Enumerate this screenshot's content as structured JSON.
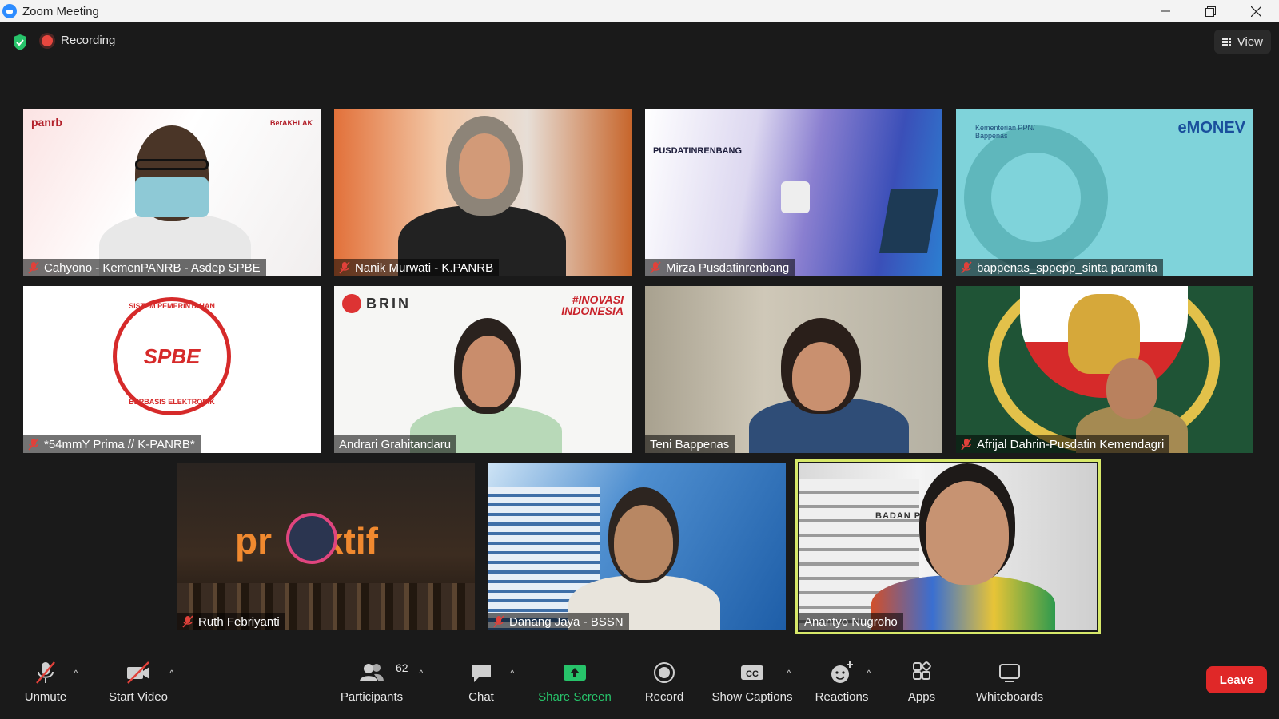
{
  "window": {
    "title": "Zoom Meeting",
    "controls": [
      "minimize",
      "restore",
      "close"
    ]
  },
  "status": {
    "recording_label": "Recording",
    "view_label": "View"
  },
  "participants_tiles": [
    {
      "name": "Cahyono - KemenPANRB - Asdep SPBE",
      "muted": true
    },
    {
      "name": "Nanik Murwati - K.PANRB",
      "muted": true
    },
    {
      "name": "Mirza Pusdatinrenbang",
      "muted": true
    },
    {
      "name": "bappenas_sppepp_sinta paramita",
      "muted": true
    },
    {
      "name": "*54mmY Prima // K-PANRB*",
      "muted": true
    },
    {
      "name": "Andrari Grahitandaru",
      "muted": false
    },
    {
      "name": "Teni Bappenas",
      "muted": false
    },
    {
      "name": "Afrijal Dahrin-Pusdatin Kemendagri",
      "muted": true
    },
    {
      "name": "Ruth Febriyanti",
      "muted": true
    },
    {
      "name": "Danang Jaya - BSSN",
      "muted": true
    },
    {
      "name": "Anantyo Nugroho",
      "muted": false,
      "active_speaker": true
    }
  ],
  "tile_texts": {
    "panrb_logo": "panrb",
    "berakhlak": "BerAKHLAK",
    "pusdatin": "PUSDATINRENBANG",
    "kementerian": "Kementerian PPN/ Bappenas",
    "emonev": "eMONEV",
    "spbe_top": "SISTEM PEMERINTAHAN",
    "spbe_mid": "SPBE",
    "spbe_bottom": "BERBASIS ELEKTRONIK",
    "brin": "BRIN",
    "inovasi": "#INOVASI INDONESIA",
    "proaktif": "pr   aktif",
    "badan": "BADAN PE"
  },
  "toolbar": {
    "unmute": "Unmute",
    "start_video": "Start Video",
    "participants": "Participants",
    "participants_count": "62",
    "chat": "Chat",
    "share_screen": "Share Screen",
    "record": "Record",
    "show_captions": "Show Captions",
    "reactions": "Reactions",
    "apps": "Apps",
    "whiteboards": "Whiteboards",
    "leave": "Leave"
  },
  "colors": {
    "background": "#1a1a1a",
    "share_green": "#27c36a",
    "leave_red": "#e02828",
    "active_speaker_border": "#d7e86a",
    "recording_red": "#e8473f",
    "muted_red": "#e0413a"
  }
}
